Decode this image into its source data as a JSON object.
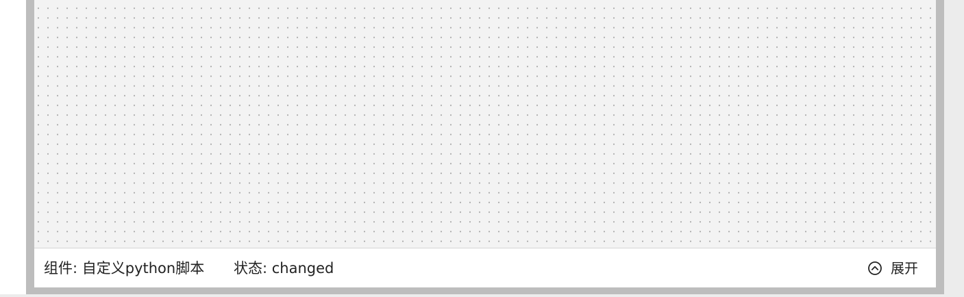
{
  "status_bar": {
    "component_label": "组件: 自定义python脚本",
    "state_label": "状态: changed",
    "expand_label": "展开"
  },
  "icons": {
    "expand": "chevron-up-circle-icon"
  },
  "colors": {
    "canvas_background": "#f3f3f3",
    "frame_border": "#bdbdbd",
    "grid_dot": "#a9a9a9"
  }
}
